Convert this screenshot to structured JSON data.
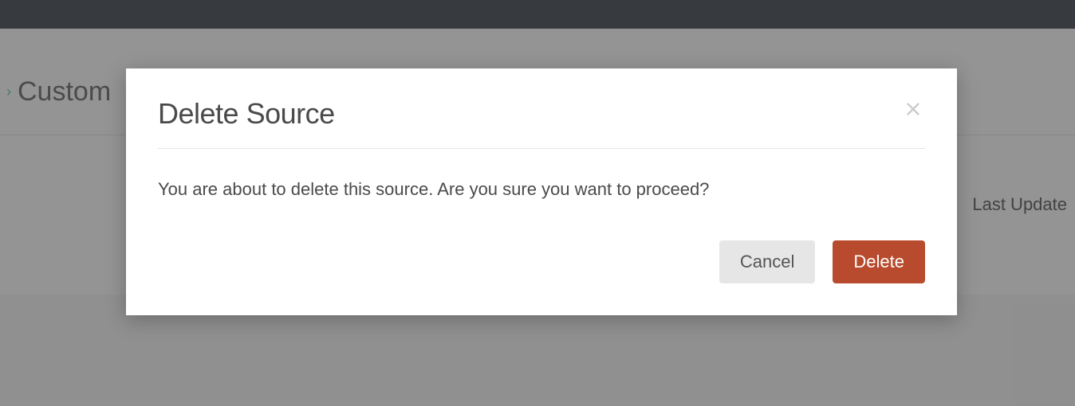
{
  "breadcrumb": {
    "current": "Custom"
  },
  "table": {
    "headers": {
      "last_update": "Last Update"
    }
  },
  "modal": {
    "title": "Delete Source",
    "body": "You are about to delete this source. Are you sure you want to proceed?",
    "cancel_label": "Cancel",
    "confirm_label": "Delete"
  }
}
